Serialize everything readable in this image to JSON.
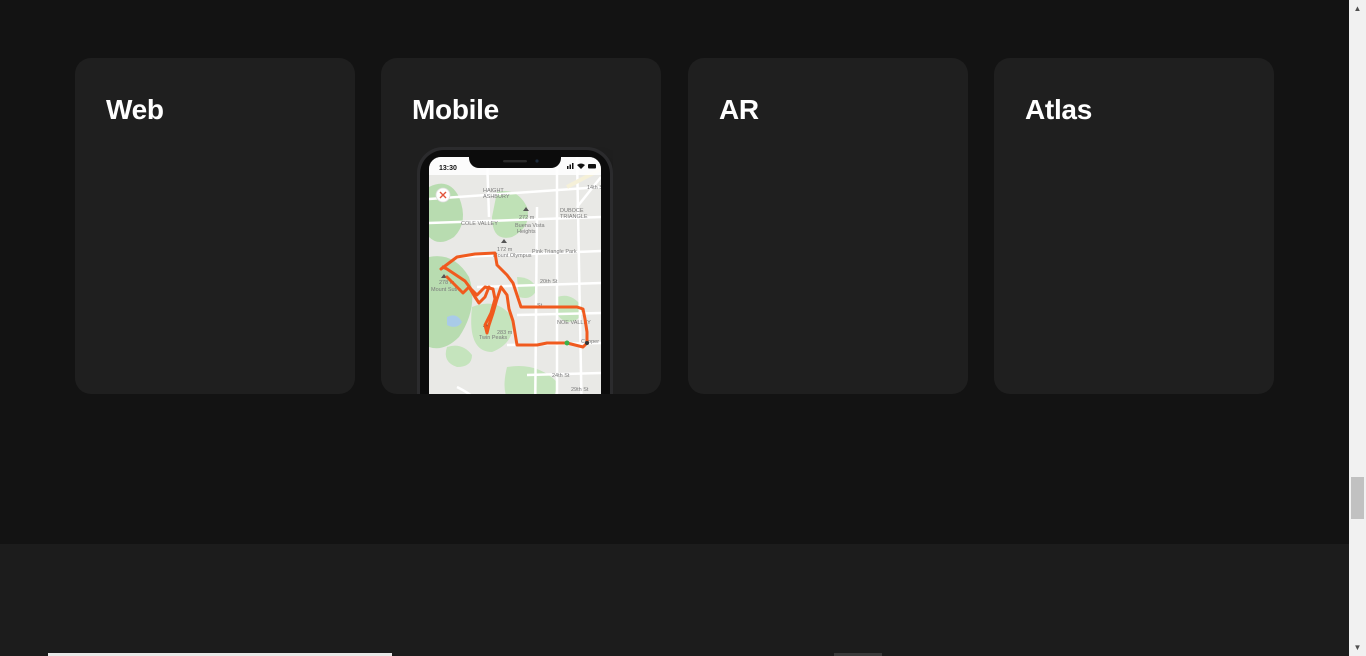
{
  "cards": [
    {
      "title": "Web"
    },
    {
      "title": "Mobile"
    },
    {
      "title": "AR"
    },
    {
      "title": "Atlas"
    }
  ],
  "phone": {
    "time": "13:30",
    "map_labels": {
      "haight": "HAIGHT",
      "ashbury": "ASHBURY",
      "cole_valley": "COLE VALLEY",
      "duboce": "DUBOCE",
      "triangle": "TRIANGLE",
      "buena_vista": "Buena Vista",
      "heights": "Heights",
      "elev_272": "272 m",
      "mount_olympus": "Mount Olympus",
      "elev_172": "172 m",
      "pink_triangle_park": "Pink Triangle Park",
      "street_20th": "20th St",
      "mount_sutro": "Mount Sutro",
      "elev_278": "278 m",
      "noe_valley": "NOE VALLEY",
      "twin_peaks": "Twin Peaks",
      "elev_283": "283 m",
      "street_24th": "24th St",
      "street_29th": "29th St",
      "street_14th": "14th St",
      "st": "St",
      "cooper_st": "Cooper St"
    },
    "route_color": "#f05a1e"
  },
  "scrollbar": {
    "up_icon": "▲",
    "down_icon": "▼"
  },
  "colors": {
    "background": "#131313",
    "card": "#1f1f1f",
    "footer": "#1c1c1c",
    "title": "#ffffff"
  }
}
